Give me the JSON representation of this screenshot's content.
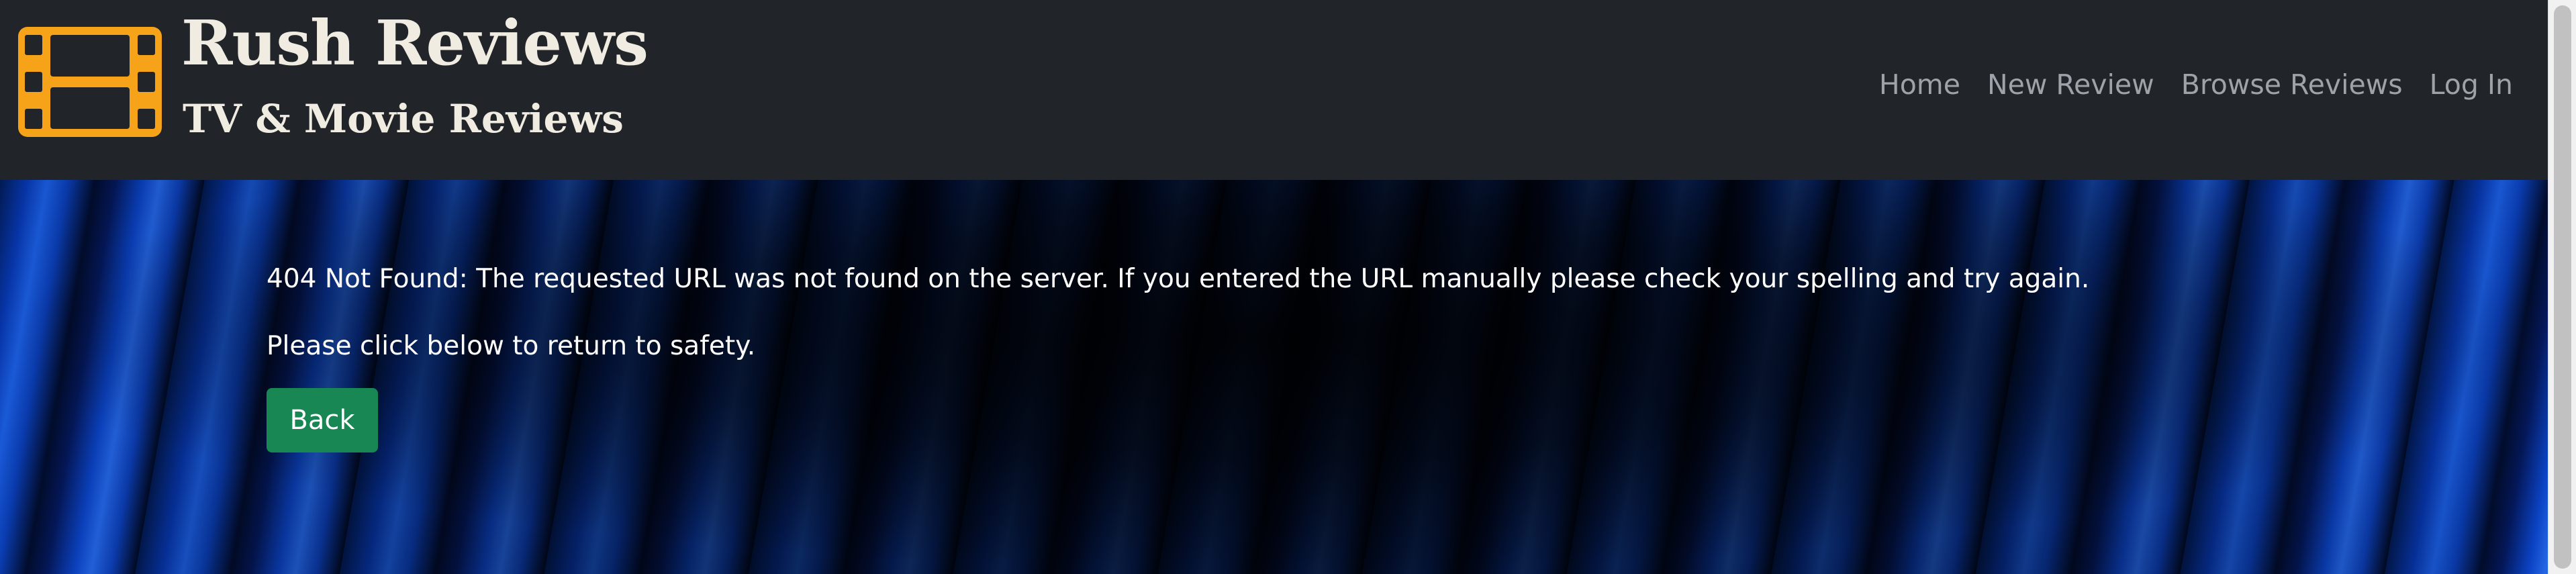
{
  "brand": {
    "title": "Rush Reviews",
    "subtitle": "TV & Movie Reviews",
    "logo_icon": "film-strip-icon",
    "logo_color": "#f7a319"
  },
  "nav": {
    "items": [
      {
        "label": "Home"
      },
      {
        "label": "New Review"
      },
      {
        "label": "Browse Reviews"
      },
      {
        "label": "Log In"
      }
    ]
  },
  "main": {
    "error_message": "404 Not Found: The requested URL was not found on the server. If you entered the URL manually please check your spelling and try again.",
    "instruction": "Please click below to return to safety.",
    "back_label": "Back"
  },
  "colors": {
    "navbar_bg": "#212529",
    "nav_link": "#9ea3a9",
    "brand_text": "#f1ece1",
    "button_bg": "#198754",
    "curtain_blue": "#0b43c4"
  }
}
